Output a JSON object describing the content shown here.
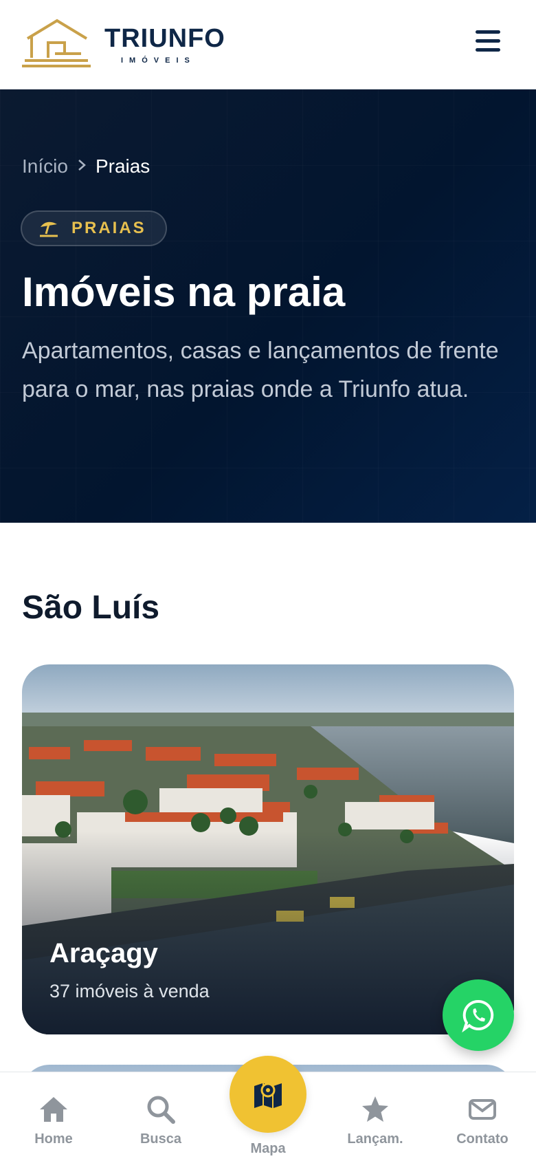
{
  "brand": {
    "name": "TRIUNFO",
    "subtitle": "IMÓVEIS"
  },
  "hero": {
    "breadcrumb": {
      "home": "Início",
      "current": "Praias"
    },
    "tag": "PRAIAS",
    "title": "Imóveis na praia",
    "description": "Apartamentos, casas e lançamentos de frente para o mar, nas praias onde a Triunfo atua."
  },
  "section": {
    "title": "São Luís",
    "cards": [
      {
        "title": "Araçagy",
        "subtitle": "37 imóveis à venda"
      }
    ]
  },
  "nav": {
    "items": [
      {
        "label": "Home",
        "icon": "home-icon"
      },
      {
        "label": "Busca",
        "icon": "search-icon"
      },
      {
        "label": "Mapa",
        "icon": "map-icon"
      },
      {
        "label": "Lançam.",
        "icon": "star-icon"
      },
      {
        "label": "Contato",
        "icon": "envelope-icon"
      }
    ]
  },
  "colors": {
    "navy": "#0f2747",
    "gold": "#e7c04f",
    "accent": "#f0c232",
    "whatsapp": "#25d366",
    "hero_bg": "#02152f"
  }
}
